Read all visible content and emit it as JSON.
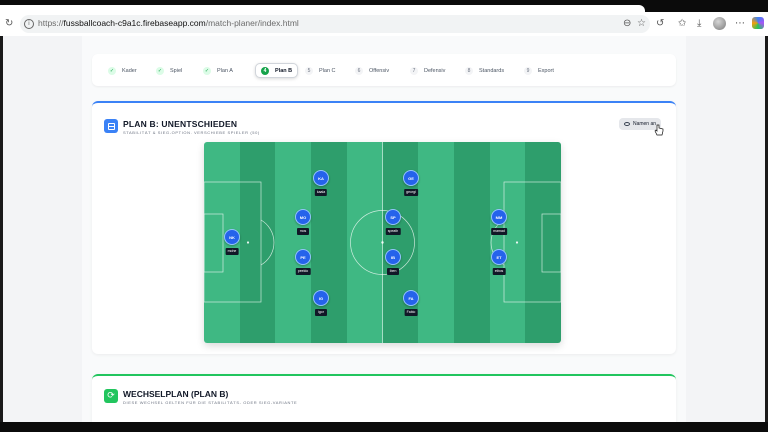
{
  "browser": {
    "url_prefix": "https://",
    "url_host": "fussballcoach-c9a1c.firebaseapp.com",
    "url_path": "/match-planer/index.html",
    "icons": [
      "refresh-icon",
      "lock-icon",
      "zoom-icon",
      "star-icon",
      "sync-icon",
      "favorites-icon",
      "download-icon",
      "profile-avatar",
      "more-icon",
      "copilot-icon"
    ]
  },
  "stepper": {
    "steps": [
      {
        "num": "✓",
        "label": "Kader",
        "state": "done"
      },
      {
        "num": "✓",
        "label": "Spiel",
        "state": "done"
      },
      {
        "num": "✓",
        "label": "Plan A",
        "state": "done"
      },
      {
        "num": "4",
        "label": "Plan B",
        "state": "active"
      },
      {
        "num": "5",
        "label": "Plan C",
        "state": "todo"
      },
      {
        "num": "6",
        "label": "Offensiv",
        "state": "todo"
      },
      {
        "num": "7",
        "label": "Defensiv",
        "state": "todo"
      },
      {
        "num": "8",
        "label": "Standards",
        "state": "todo"
      },
      {
        "num": "9",
        "label": "Export",
        "state": "todo"
      }
    ]
  },
  "plan_b": {
    "title": "PLAN B: UNENTSCHIEDEN",
    "subtitle": "STABILITÄT & SIEG-OPTION. VERSCHIEBE SPIELER (50)",
    "names_button": "Namen an",
    "players": [
      {
        "initials": "NK",
        "name": "mohe"
      },
      {
        "initials": "KA",
        "name": "kaala"
      },
      {
        "initials": "MO",
        "name": "mos"
      },
      {
        "initials": "PE",
        "name": "peeldo"
      },
      {
        "initials": "IG",
        "name": "igor"
      },
      {
        "initials": "GE",
        "name": "georgi"
      },
      {
        "initials": "SP",
        "name": "speath"
      },
      {
        "initials": "IB",
        "name": "Iben"
      },
      {
        "initials": "FA",
        "name": "Fabio"
      },
      {
        "initials": "MM",
        "name": "mamad"
      },
      {
        "initials": "ET",
        "name": "etbos"
      }
    ]
  },
  "wechselplan": {
    "title": "WECHSELPLAN (PLAN B)",
    "subtitle": "DIESE WECHSEL GELTEN FÜR DIE STABILITÄTS- ODER SIEG-VARIANTE"
  },
  "colors": {
    "accent_blue": "#3b82f6",
    "accent_green": "#22c55e",
    "pitch_light": "#3fb883",
    "pitch_dark": "#2e9e6c",
    "player_blue": "#2563eb"
  }
}
